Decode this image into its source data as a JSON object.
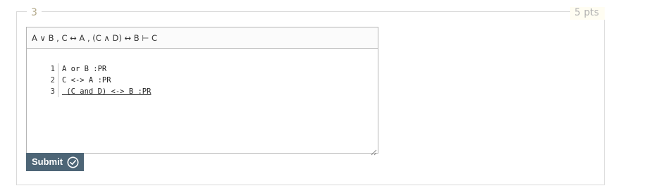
{
  "problem": {
    "number": "3",
    "points": "5 pts"
  },
  "sequent": "A ∨ B , C ↔ A , (C ∧ D) ↔ B ⊢ C",
  "proof": {
    "lines": [
      {
        "num": "1",
        "text": "A or B :PR"
      },
      {
        "num": "2",
        "text": "C <-> A :PR"
      },
      {
        "num": "3",
        "text": " (C and D) <-> B :PR"
      }
    ]
  },
  "submit": {
    "label": "Submit",
    "icon": "check-circle-icon",
    "color": "#4d6576"
  }
}
